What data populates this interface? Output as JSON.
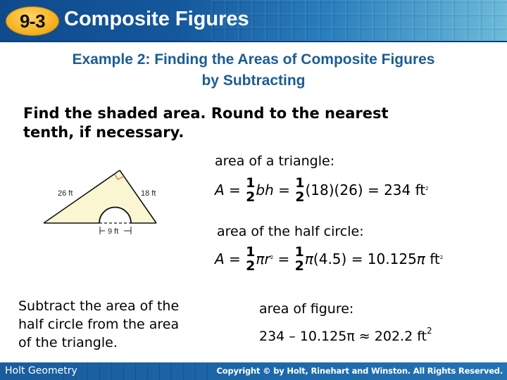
{
  "header": {
    "lesson_number": "9-3",
    "title": "Composite Figures"
  },
  "example": {
    "heading_line1": "Example 2: Finding the Areas of Composite Figures",
    "heading_line2": "by Subtracting"
  },
  "prompt": {
    "line1": "Find the shaded area. Round to the nearest",
    "line2": "tenth, if necessary."
  },
  "figure": {
    "side_left_label": "26 ft",
    "side_right_label": "18 ft",
    "diameter_label": "9 ft",
    "fill_color": "#fbf6d2",
    "right_angle_color": "#c0392b"
  },
  "triangle_area": {
    "label": "area of a triangle:",
    "lhs": "A",
    "eq1": " = ",
    "frac_num": "1",
    "frac_den": "2",
    "vars": "bh",
    "eq2": " = ",
    "values": "(18)(26) = 234 ft",
    "unit_exp": "2"
  },
  "half_circle_area": {
    "label": "area of the half circle:",
    "lhs": "A",
    "eq1": " = ",
    "frac_num": "1",
    "frac_den": "2",
    "pi": "π",
    "r": "r",
    "r_exp": "2",
    "eq2": " = ",
    "values": "(4.5) = 10.125",
    "unit": " ft",
    "unit_exp": "2"
  },
  "explanation": {
    "line1": "Subtract the area of the",
    "line2": "half circle from the area",
    "line3": "of the triangle."
  },
  "figure_area": {
    "label": "area of figure:",
    "expression": "234 – 10.125π ≈ 202.2 ft",
    "unit_exp": "2"
  },
  "footer": {
    "left": "Holt Geometry",
    "right": "Copyright © by Holt, Rinehart and Winston. All Rights Reserved."
  }
}
